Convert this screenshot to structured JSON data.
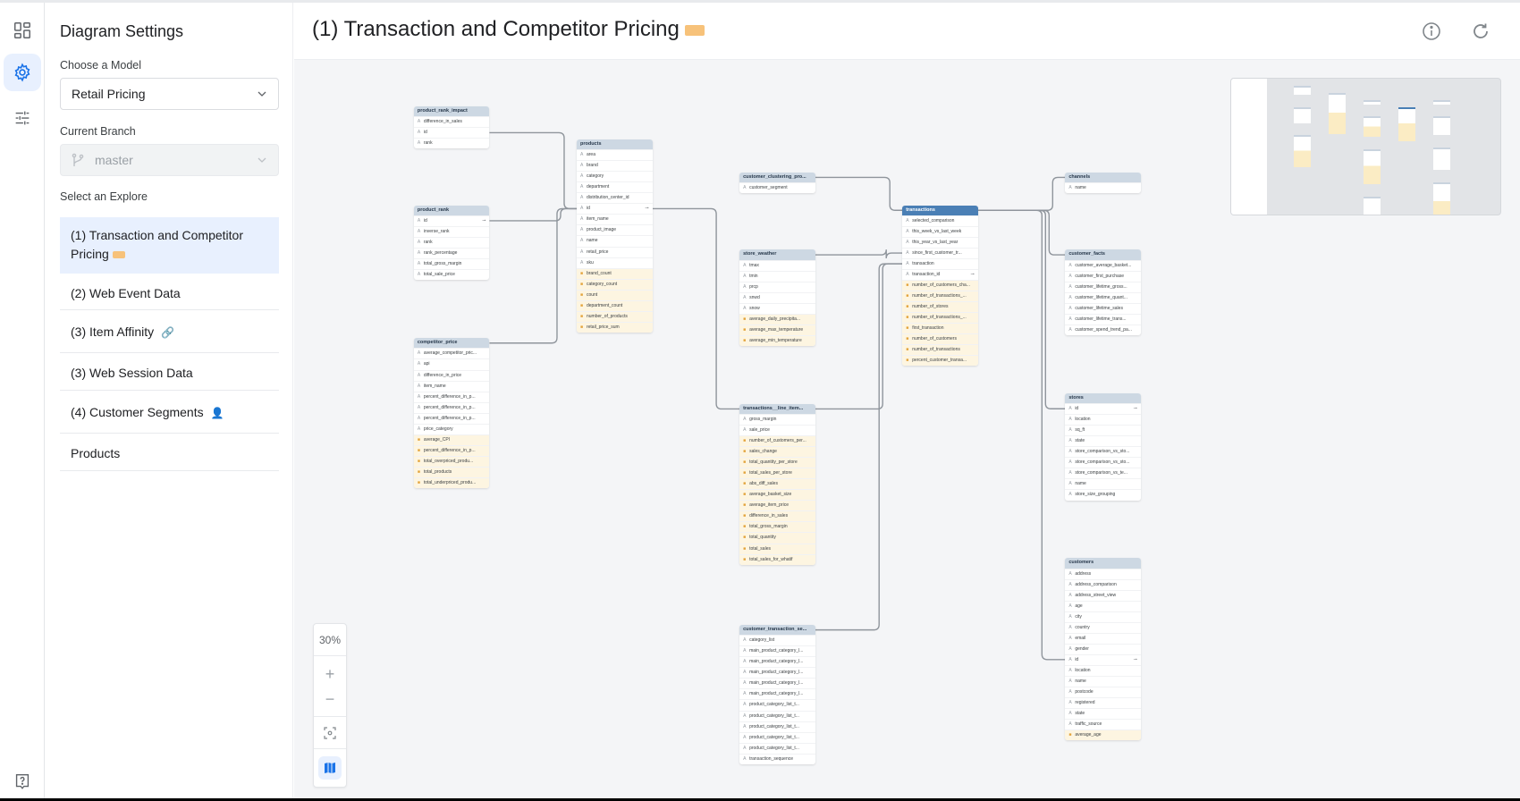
{
  "rail": {
    "items": [
      {
        "icon": "dashboard-grid-icon",
        "active": false
      },
      {
        "icon": "gear-icon",
        "active": true
      },
      {
        "icon": "sliders-icon",
        "active": false
      }
    ],
    "help_icon": "help-icon"
  },
  "settings": {
    "title": "Diagram Settings",
    "model_label": "Choose a Model",
    "model_value": "Retail Pricing",
    "branch_label": "Current Branch",
    "branch_value": "master",
    "explore_label": "Select an Explore",
    "explores": [
      {
        "label": "(1) Transaction and Competitor Pricing",
        "emoji": "tag",
        "active": true
      },
      {
        "label": "(2) Web Event Data",
        "emoji": "",
        "active": false
      },
      {
        "label": "(3) Item Affinity",
        "emoji": "🔗",
        "active": false
      },
      {
        "label": "(3) Web Session Data",
        "emoji": "",
        "active": false
      },
      {
        "label": "(4) Customer Segments",
        "emoji": "👤",
        "active": false
      },
      {
        "label": "Products",
        "emoji": "",
        "active": false
      }
    ]
  },
  "header": {
    "title": "(1) Transaction and Competitor Pricing",
    "info_icon": "info-icon",
    "refresh_icon": "refresh-icon"
  },
  "zoom": {
    "level": "30%",
    "plus": "+",
    "minus": "−"
  },
  "diagram": {
    "nodes": [
      {
        "id": "product_rank_impact",
        "title": "product_rank_impact",
        "fields": [
          {
            "n": "difference_in_sales",
            "m": false
          },
          {
            "n": "id",
            "m": false
          },
          {
            "n": "rank",
            "m": false
          }
        ]
      },
      {
        "id": "product_rank",
        "title": "product_rank",
        "fields": [
          {
            "n": "id",
            "m": false,
            "k": true
          },
          {
            "n": "inverse_rank",
            "m": false
          },
          {
            "n": "rank",
            "m": false
          },
          {
            "n": "rank_percentage",
            "m": false
          },
          {
            "n": "total_gross_margin",
            "m": false
          },
          {
            "n": "total_sale_price",
            "m": false
          }
        ]
      },
      {
        "id": "competitor_price",
        "title": "competitor_price",
        "fields": [
          {
            "n": "average_competitor_pric...",
            "m": false
          },
          {
            "n": "api",
            "m": false
          },
          {
            "n": "difference_in_price",
            "m": false
          },
          {
            "n": "item_name",
            "m": false
          },
          {
            "n": "percent_difference_in_p...",
            "m": false
          },
          {
            "n": "percent_difference_in_p...",
            "m": false
          },
          {
            "n": "percent_difference_in_p...",
            "m": false
          },
          {
            "n": "price_category",
            "m": false
          },
          {
            "n": "average_CPI",
            "m": true
          },
          {
            "n": "percent_difference_in_p...",
            "m": true
          },
          {
            "n": "total_overpriced_produ...",
            "m": true
          },
          {
            "n": "total_products",
            "m": true
          },
          {
            "n": "total_underpriced_produ...",
            "m": true
          }
        ]
      },
      {
        "id": "products",
        "title": "products",
        "fields": [
          {
            "n": "area",
            "m": false
          },
          {
            "n": "brand",
            "m": false
          },
          {
            "n": "category",
            "m": false
          },
          {
            "n": "department",
            "m": false
          },
          {
            "n": "distribution_center_id",
            "m": false
          },
          {
            "n": "id",
            "m": false,
            "k": true
          },
          {
            "n": "item_name",
            "m": false
          },
          {
            "n": "product_image",
            "m": false
          },
          {
            "n": "name",
            "m": false
          },
          {
            "n": "retail_price",
            "m": false
          },
          {
            "n": "sku",
            "m": false
          },
          {
            "n": "brand_count",
            "m": true
          },
          {
            "n": "category_count",
            "m": true
          },
          {
            "n": "count",
            "m": true
          },
          {
            "n": "department_count",
            "m": true
          },
          {
            "n": "number_of_products",
            "m": true
          },
          {
            "n": "retail_price_sum",
            "m": true
          }
        ]
      },
      {
        "id": "customer_clustering",
        "title": "customer_clustering_pro...",
        "fields": [
          {
            "n": "customer_segment",
            "m": false
          }
        ]
      },
      {
        "id": "store_weather",
        "title": "store_weather",
        "fields": [
          {
            "n": "tmax",
            "m": false
          },
          {
            "n": "tmin",
            "m": false
          },
          {
            "n": "prcp",
            "m": false
          },
          {
            "n": "snwd",
            "m": false
          },
          {
            "n": "snow",
            "m": false
          },
          {
            "n": "average_daily_precipita...",
            "m": true
          },
          {
            "n": "average_max_temperature",
            "m": true
          },
          {
            "n": "average_min_temperature",
            "m": true
          }
        ]
      },
      {
        "id": "transactions_line_items",
        "title": "transactions__line_item...",
        "fields": [
          {
            "n": "gross_margin",
            "m": false
          },
          {
            "n": "sale_price",
            "m": false
          },
          {
            "n": "number_of_customers_per...",
            "m": true
          },
          {
            "n": "sales_change",
            "m": true
          },
          {
            "n": "total_quantity_per_store",
            "m": true
          },
          {
            "n": "total_sales_per_store",
            "m": true
          },
          {
            "n": "abs_diff_sales",
            "m": true
          },
          {
            "n": "average_basket_size",
            "m": true
          },
          {
            "n": "average_item_price",
            "m": true
          },
          {
            "n": "difference_in_sales",
            "m": true
          },
          {
            "n": "total_gross_margin",
            "m": true
          },
          {
            "n": "total_quantity",
            "m": true
          },
          {
            "n": "total_sales",
            "m": true
          },
          {
            "n": "total_sales_for_whatif",
            "m": true
          }
        ]
      },
      {
        "id": "customer_transaction_seq",
        "title": "customer_transaction_se...",
        "fields": [
          {
            "n": "category_list",
            "m": false
          },
          {
            "n": "main_product_category_l...",
            "m": false
          },
          {
            "n": "main_product_category_l...",
            "m": false
          },
          {
            "n": "main_product_category_l...",
            "m": false
          },
          {
            "n": "main_product_category_l...",
            "m": false
          },
          {
            "n": "main_product_category_l...",
            "m": false
          },
          {
            "n": "product_category_list_t...",
            "m": false
          },
          {
            "n": "product_category_list_t...",
            "m": false
          },
          {
            "n": "product_category_list_t...",
            "m": false
          },
          {
            "n": "product_category_list_t...",
            "m": false
          },
          {
            "n": "product_category_list_t...",
            "m": false
          },
          {
            "n": "transaction_sequence",
            "m": false
          }
        ]
      },
      {
        "id": "transactions",
        "title": "transactions",
        "primary": true,
        "fields": [
          {
            "n": "selected_comparison",
            "m": false
          },
          {
            "n": "this_week_vs_last_week",
            "m": false
          },
          {
            "n": "this_year_vs_last_year",
            "m": false
          },
          {
            "n": "since_first_customer_tr...",
            "m": false
          },
          {
            "n": "transaction",
            "m": false
          },
          {
            "n": "transaction_id",
            "m": false,
            "k": true
          },
          {
            "n": "number_of_customers_cha...",
            "m": true
          },
          {
            "n": "number_of_transactions_...",
            "m": true
          },
          {
            "n": "number_of_stores",
            "m": true
          },
          {
            "n": "number_of_transactions_...",
            "m": true
          },
          {
            "n": "first_transaction",
            "m": true
          },
          {
            "n": "number_of_customers",
            "m": true
          },
          {
            "n": "number_of_transactions",
            "m": true
          },
          {
            "n": "percent_customer_transa...",
            "m": true
          }
        ]
      },
      {
        "id": "channels",
        "title": "channels",
        "fields": [
          {
            "n": "name",
            "m": false
          }
        ]
      },
      {
        "id": "customer_facts",
        "title": "customer_facts",
        "fields": [
          {
            "n": "customer_average_basket...",
            "m": false
          },
          {
            "n": "customer_first_purchase",
            "m": false
          },
          {
            "n": "customer_lifetime_gross...",
            "m": false
          },
          {
            "n": "customer_lifetime_quant...",
            "m": false
          },
          {
            "n": "customer_lifetime_sales",
            "m": false
          },
          {
            "n": "customer_lifetime_trans...",
            "m": false
          },
          {
            "n": "customer_spend_trend_pa...",
            "m": false
          }
        ]
      },
      {
        "id": "stores",
        "title": "stores",
        "fields": [
          {
            "n": "id",
            "m": false,
            "k": true
          },
          {
            "n": "location",
            "m": false
          },
          {
            "n": "sq_ft",
            "m": false
          },
          {
            "n": "state",
            "m": false
          },
          {
            "n": "store_comparison_vs_sto...",
            "m": false
          },
          {
            "n": "store_comparison_vs_sto...",
            "m": false
          },
          {
            "n": "store_comparison_vs_te...",
            "m": false
          },
          {
            "n": "name",
            "m": false
          },
          {
            "n": "store_size_grouping",
            "m": false
          }
        ]
      },
      {
        "id": "customers",
        "title": "customers",
        "fields": [
          {
            "n": "address",
            "m": false
          },
          {
            "n": "address_comparison",
            "m": false
          },
          {
            "n": "address_street_view",
            "m": false
          },
          {
            "n": "age",
            "m": false
          },
          {
            "n": "city",
            "m": false
          },
          {
            "n": "country",
            "m": false
          },
          {
            "n": "email",
            "m": false
          },
          {
            "n": "gender",
            "m": false
          },
          {
            "n": "id",
            "m": false,
            "k": true
          },
          {
            "n": "location",
            "m": false
          },
          {
            "n": "name",
            "m": false
          },
          {
            "n": "postcode",
            "m": false
          },
          {
            "n": "registered",
            "m": false
          },
          {
            "n": "state",
            "m": false
          },
          {
            "n": "traffic_source",
            "m": false
          },
          {
            "n": "average_age",
            "m": true
          }
        ]
      }
    ]
  }
}
